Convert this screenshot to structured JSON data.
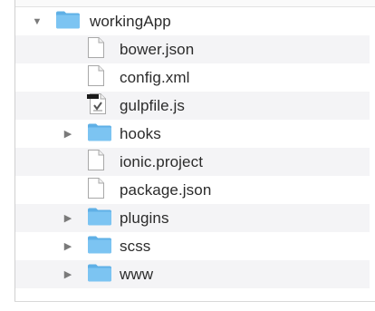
{
  "tree": {
    "root": {
      "label": "workingApp",
      "expanded": true,
      "icon": "folder-icon"
    },
    "items": [
      {
        "label": "bower.json",
        "kind": "file",
        "icon": "document-icon"
      },
      {
        "label": "config.xml",
        "kind": "file",
        "icon": "document-icon"
      },
      {
        "label": "gulpfile.js",
        "kind": "script",
        "icon": "script-document-icon"
      },
      {
        "label": "hooks",
        "kind": "folder",
        "icon": "folder-icon",
        "expanded": false
      },
      {
        "label": "ionic.project",
        "kind": "file",
        "icon": "document-icon"
      },
      {
        "label": "package.json",
        "kind": "file",
        "icon": "document-icon"
      },
      {
        "label": "plugins",
        "kind": "folder",
        "icon": "folder-icon",
        "expanded": false
      },
      {
        "label": "scss",
        "kind": "folder",
        "icon": "folder-icon",
        "expanded": false
      },
      {
        "label": "www",
        "kind": "folder",
        "icon": "folder-icon",
        "expanded": false
      }
    ]
  },
  "colors": {
    "folder_fill": "#7cc4f2",
    "folder_tab": "#5fb0e6",
    "row_alt": "#f4f4f6",
    "text": "#2b2b2b",
    "disclosure": "#7a7a7a"
  }
}
